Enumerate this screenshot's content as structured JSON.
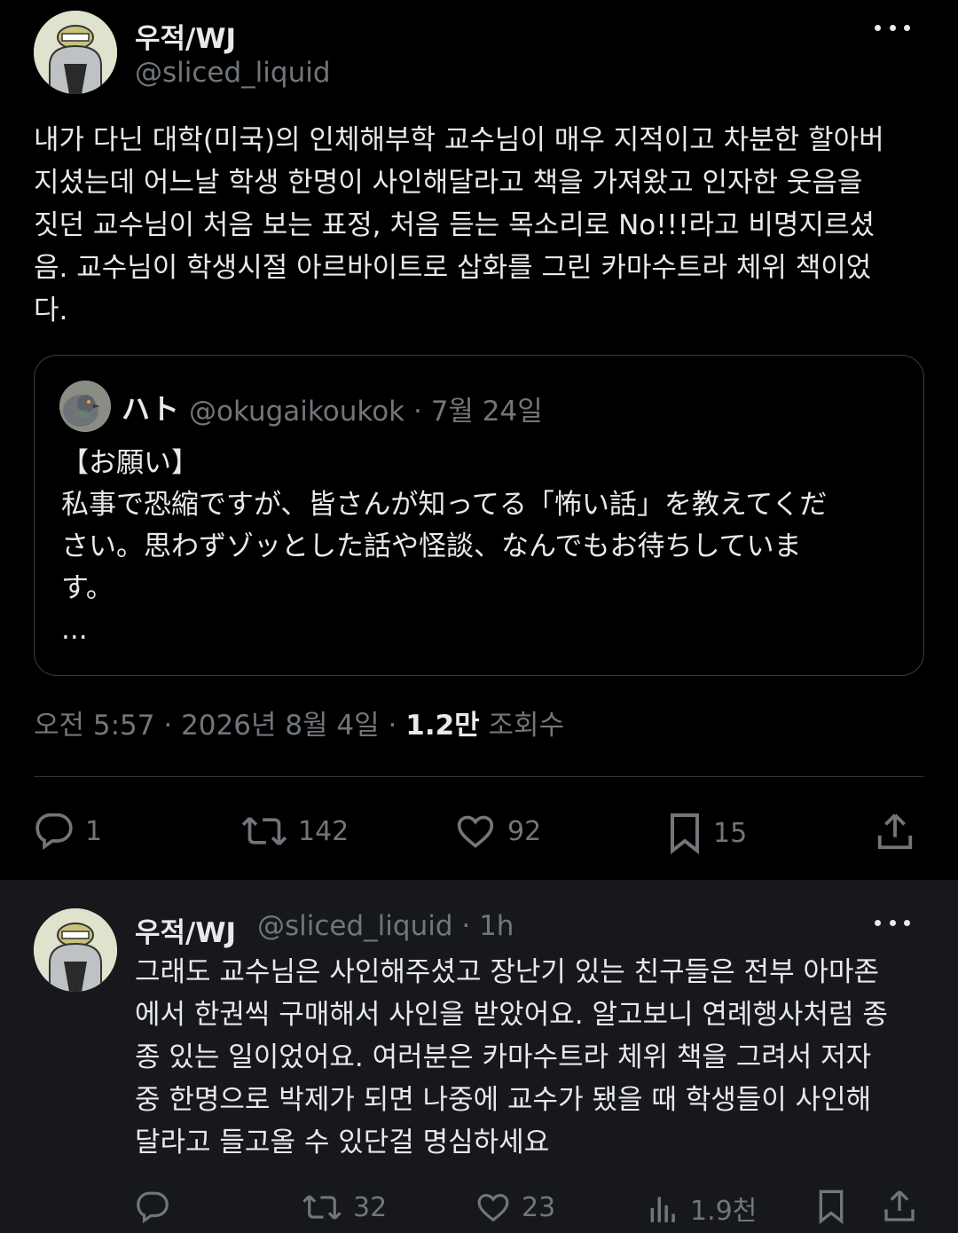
{
  "main_tweet": {
    "author_name": "우적/WJ",
    "author_handle": "@sliced_liquid",
    "text": "내가 다닌 대학(미국)의 인체해부학 교수님이 매우 지적이고 차분한 할아버\n지셨는데 어느날 학생 한명이 사인해달라고 책을 가져왔고 인자한 웃음을\n짓던 교수님이 처음 보는 표정, 처음 듣는 목소리로 No!!!라고 비명지르셨\n음. 교수님이 학생시절 아르바이트로 삽화를 그린 카마수트라 체위 책이었\n다.",
    "quote": {
      "name": "ハト",
      "handle": "@okugaikoukok · 7월 24일",
      "text": "【お願い】\n私事で恐縮ですが、皆さんが知ってる「怖い話」を教えてくだ\nさい。思わずゾッとした話や怪談、なんでもお待ちしていま\nす。\n..."
    },
    "time": "오전 5:57 · 2026년 8월 4일 · ",
    "views_count": "1.2만",
    "views_label": " 조회수",
    "actions": {
      "replies": "1",
      "reposts": "142",
      "likes": "92",
      "bookmarks": "15"
    }
  },
  "reply_tweet": {
    "author_name": "우적/WJ",
    "author_handle": "@sliced_liquid · 1h",
    "text": "그래도 교수님은 사인해주셨고 장난기 있는 친구들은 전부 아마존\n에서 한권씩 구매해서 사인을 받았어요. 알고보니 연례행사처럼 종\n종 있는 일이었어요. 여러분은 카마수트라 체위 책을 그려서 저자\n중 한명으로 박제가 되면 나중에 교수가 됐을 때 학생들이 사인해\n달라고 들고올 수 있단걸 명심하세요",
    "actions": {
      "reposts": "32",
      "likes": "23",
      "views": "1.9천"
    }
  },
  "colors": {
    "background": "#000000",
    "reply_background": "#16181c",
    "text": "#e7e9ea",
    "muted": "#71767b",
    "border": "#2f3336"
  },
  "icons": [
    "reply-icon",
    "repost-icon",
    "like-icon",
    "bookmark-icon",
    "share-icon",
    "views-icon",
    "more-icon"
  ]
}
